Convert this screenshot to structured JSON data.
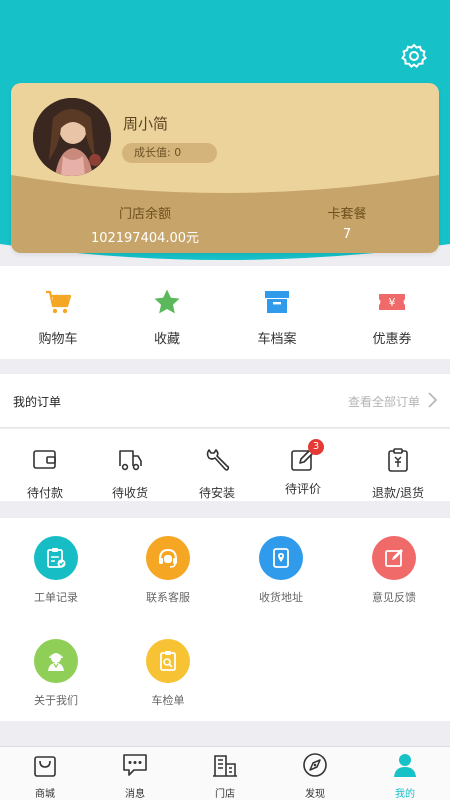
{
  "profile": {
    "username": "周小简",
    "growth_label": "成长值:",
    "growth_value": "0"
  },
  "stats": [
    {
      "label": "门店余额",
      "value": "102197404.00元"
    },
    {
      "label": "卡套餐",
      "value": "7"
    }
  ],
  "quick_actions": [
    {
      "label": "购物车",
      "icon": "cart-icon"
    },
    {
      "label": "收藏",
      "icon": "star-icon"
    },
    {
      "label": "车档案",
      "icon": "archive-box-icon"
    },
    {
      "label": "优惠券",
      "icon": "coupon-icon"
    }
  ],
  "orders": {
    "title": "我的订单",
    "view_all": "查看全部订单",
    "items": [
      {
        "label": "待付款",
        "icon": "wallet-icon"
      },
      {
        "label": "待收货",
        "icon": "truck-icon"
      },
      {
        "label": "待安装",
        "icon": "wrench-icon"
      },
      {
        "label": "待评价",
        "icon": "edit-icon",
        "badge": "3"
      },
      {
        "label": "退款/退货",
        "icon": "refund-clipboard-icon"
      }
    ]
  },
  "services": [
    {
      "label": "工单记录",
      "icon": "clipboard-check-icon",
      "color": "#16bdc5"
    },
    {
      "label": "联系客服",
      "icon": "headset-icon",
      "color": "#f5a623"
    },
    {
      "label": "收货地址",
      "icon": "address-book-icon",
      "color": "#2f9bea"
    },
    {
      "label": "意见反馈",
      "icon": "feedback-edit-icon",
      "color": "#f06a6a"
    },
    {
      "label": "关于我们",
      "icon": "person-icon",
      "color": "#8fcf57"
    },
    {
      "label": "车检单",
      "icon": "inspection-icon",
      "color": "#f7c234"
    }
  ],
  "tabs": [
    {
      "label": "商城",
      "icon": "shopping-bag-icon"
    },
    {
      "label": "消息",
      "icon": "message-icon"
    },
    {
      "label": "门店",
      "icon": "store-icon"
    },
    {
      "label": "发现",
      "icon": "discover-icon"
    },
    {
      "label": "我的",
      "icon": "profile-icon",
      "active": true
    }
  ],
  "colors": {
    "accent": "#17c1c8",
    "card_gold": "#ecd29b",
    "card_gold_dark": "#c7a56a",
    "badge_red": "#e53935"
  }
}
